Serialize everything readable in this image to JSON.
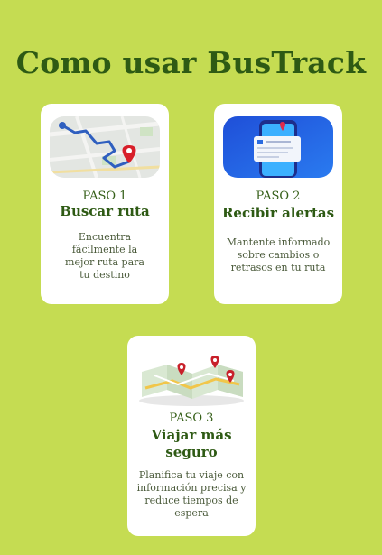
{
  "page": {
    "title": "Como usar BusTrack"
  },
  "steps": [
    {
      "step_label": "PASO 1",
      "name": "Buscar ruta",
      "description": "Encuentra fácilmente la mejor ruta para tu destino",
      "image_icon": "map-route-icon"
    },
    {
      "step_label": "PASO 2",
      "name": "Recibir alertas",
      "description": "Mantente informado sobre cambios o retrasos en tu ruta",
      "image_icon": "phone-notification-icon"
    },
    {
      "step_label": "PASO 3",
      "name": "Viajar más seguro",
      "description": "Planifica tu viaje con información precisa y reduce tiempos de espera",
      "image_icon": "folded-map-icon"
    }
  ],
  "colors": {
    "background": "#c5dc52",
    "card": "#ffffff",
    "heading": "#2e5a14"
  }
}
